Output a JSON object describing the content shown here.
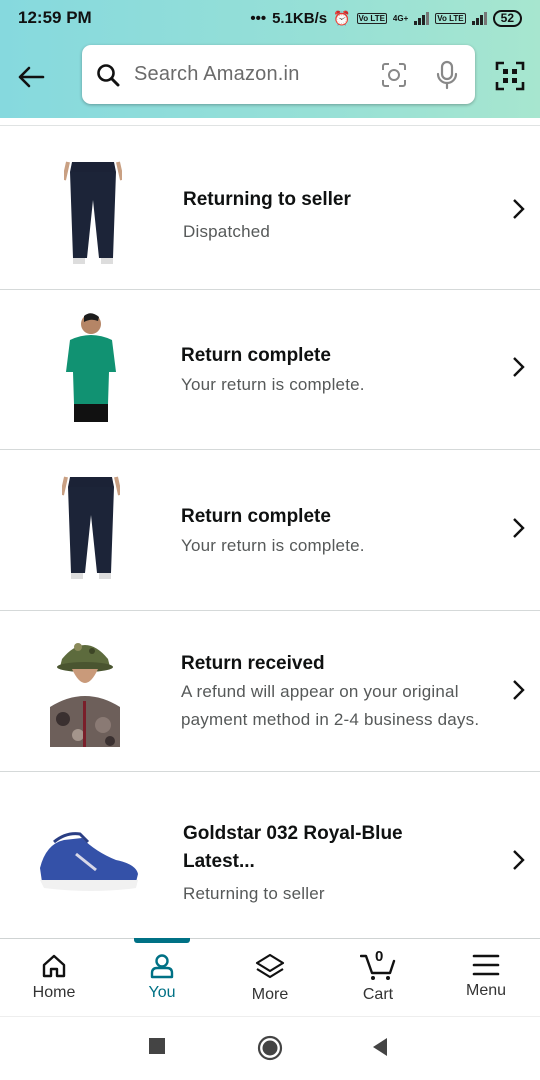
{
  "status_bar": {
    "time": "12:59 PM",
    "network_speed": "5.1KB/s",
    "alarm_icon": "alarm-icon",
    "sim1_tag": "Vo LTE",
    "net_type": "4G+",
    "sim2_tag": "Vo LTE",
    "battery": "52"
  },
  "header": {
    "back_icon": "arrow-left-icon",
    "search": {
      "placeholder": "Search Amazon.in",
      "icon": "search-icon"
    },
    "lens_icon": "camera-lens-icon",
    "mic_icon": "microphone-icon",
    "qr_icon": "qr-scanner-icon"
  },
  "orders": [
    {
      "title": "Returning to seller",
      "subtitle": "Dispatched",
      "image": "navy-track-pants"
    },
    {
      "title": "Return complete",
      "subtitle": "Your return is complete.",
      "image": "green-polo-tshirt"
    },
    {
      "title": "Return complete",
      "subtitle": "Your return is complete.",
      "image": "navy-track-pants"
    },
    {
      "title": "Return received",
      "subtitle": "A refund will appear on your original payment method in 2-4 business days.",
      "subtitle_line1": "A refund will appear on your original",
      "subtitle_line2": "payment method in 2-4 business days.",
      "image": "camo-jacket-helmet"
    },
    {
      "title": "Goldstar 032 Royal-Blue Latest...",
      "title_line1": "Goldstar 032 Royal-Blue",
      "title_line2": "Latest...",
      "subtitle": "Returning to seller",
      "image": "blue-sneakers"
    }
  ],
  "bottom_nav": {
    "items": [
      {
        "label": "Home",
        "icon": "home-icon",
        "active": false
      },
      {
        "label": "You",
        "icon": "person-icon",
        "active": true
      },
      {
        "label": "More",
        "icon": "layers-icon",
        "active": false
      },
      {
        "label": "Cart",
        "icon": "cart-icon",
        "active": false,
        "count": "0"
      },
      {
        "label": "Menu",
        "icon": "hamburger-menu-icon",
        "active": false
      }
    ]
  },
  "system_nav": {
    "recents": "recents-icon",
    "home": "home-circle-icon",
    "back": "back-triangle-icon"
  },
  "colors": {
    "header_gradient_start": "#86d9de",
    "header_gradient_end": "#a7e6cf",
    "accent": "#007185",
    "text": "#0f1111",
    "subtext": "#565959"
  }
}
